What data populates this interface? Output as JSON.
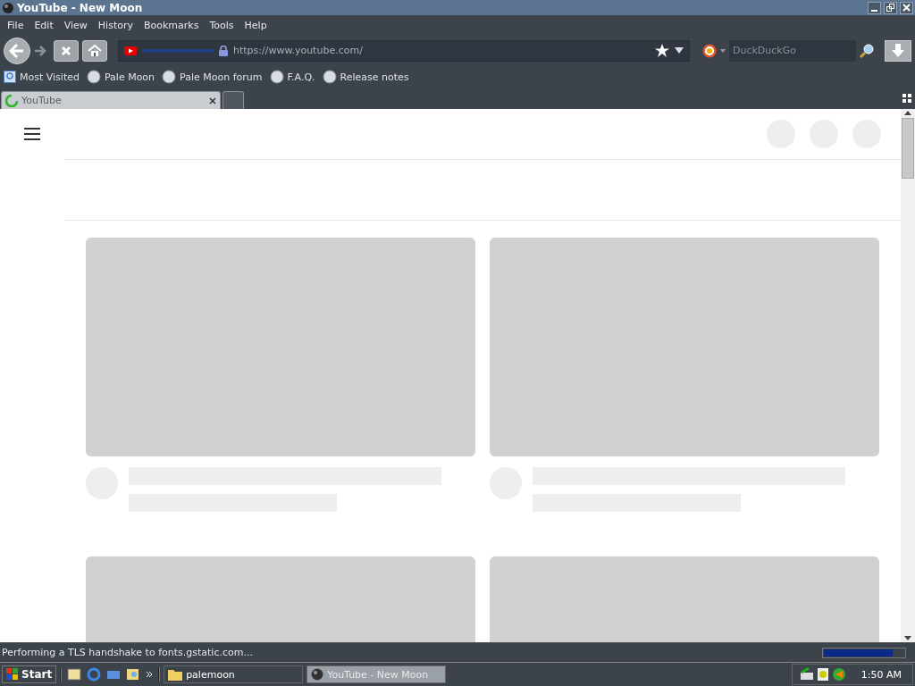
{
  "window": {
    "title": "YouTube - New Moon"
  },
  "menu": [
    "File",
    "Edit",
    "View",
    "History",
    "Bookmarks",
    "Tools",
    "Help"
  ],
  "navigation": {
    "url": "https://www.youtube.com/",
    "search_placeholder": "DuckDuckGo"
  },
  "bookmarks": [
    {
      "label": "Most Visited",
      "kind": "folder"
    },
    {
      "label": "Pale Moon",
      "kind": "page"
    },
    {
      "label": "Pale Moon forum",
      "kind": "page"
    },
    {
      "label": "F.A.Q.",
      "kind": "page"
    },
    {
      "label": "Release notes",
      "kind": "page"
    }
  ],
  "tabs": [
    {
      "label": "YouTube",
      "selected": true
    }
  ],
  "status_bar": {
    "text": "Performing a TLS handshake to fonts.gstatic.com...",
    "level": 0.85
  },
  "taskbar": {
    "start": "Start",
    "tasks": [
      {
        "label": "palemoon",
        "selected": false,
        "kind": "folder"
      },
      {
        "label": "YouTube - New Moon",
        "selected": true,
        "kind": "browser"
      }
    ],
    "clock": "1:50 AM"
  }
}
